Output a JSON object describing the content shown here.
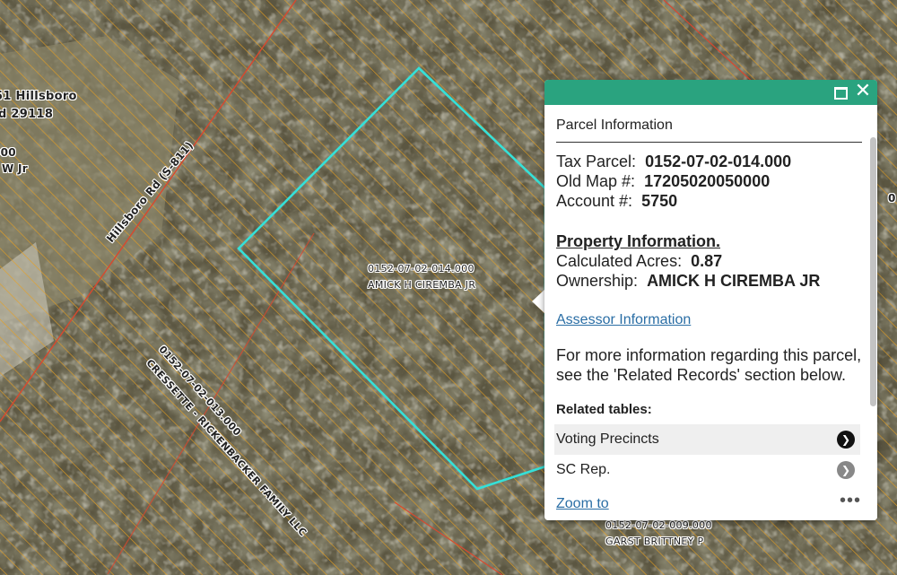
{
  "map": {
    "colors": {
      "aerial_base": "#5b5641",
      "hatch": "#e8a020",
      "parcel_line": "#d9482e",
      "selection": "#35e0d8"
    },
    "labels": {
      "hillsboro_address_a": "51 Hillsboro",
      "hillsboro_address_b": "d 29118",
      "left_parcel_a": "000",
      "left_parcel_b": "W Jr",
      "road": "Hillsboro Rd (S-811)",
      "parcel_014_id": "0152-07-02-014.000",
      "parcel_014_owner": "AMICK H CIREMBA JR",
      "parcel_013_id": "0152-07-02-013.000",
      "parcel_013_owner": "CRESSETTE - RICKENBACKER FAMILY LLC",
      "parcel_009_id": "0152-07-02-009.000",
      "parcel_009_owner": "GARST BRITTNEY P",
      "right_edge_fragment": "0"
    }
  },
  "popup": {
    "title": "Parcel Information",
    "tax_parcel_label": "Tax Parcel:",
    "tax_parcel_value": "0152-07-02-014.000",
    "old_map_label": "Old Map #:",
    "old_map_value": "17205020050000",
    "account_label": "Account #:",
    "account_value": "5750",
    "property_info_title": "Property Information.",
    "acres_label": "Calculated Acres:",
    "acres_value": "0.87",
    "ownership_label": "Ownership:",
    "ownership_value": "AMICK H CIREMBA JR",
    "assessor_link": "Assessor Information",
    "note": "For more information regarding this parcel, see the 'Related Records' section below.",
    "related_title": "Related tables:",
    "related_items": [
      {
        "label": "Voting Precincts"
      },
      {
        "label": "SC Rep."
      }
    ],
    "zoom_to": "Zoom to",
    "icons": {
      "maximize": "maximize-icon",
      "close": "close-icon",
      "more": "more-icon",
      "arrow": "chevron-right-icon"
    }
  }
}
